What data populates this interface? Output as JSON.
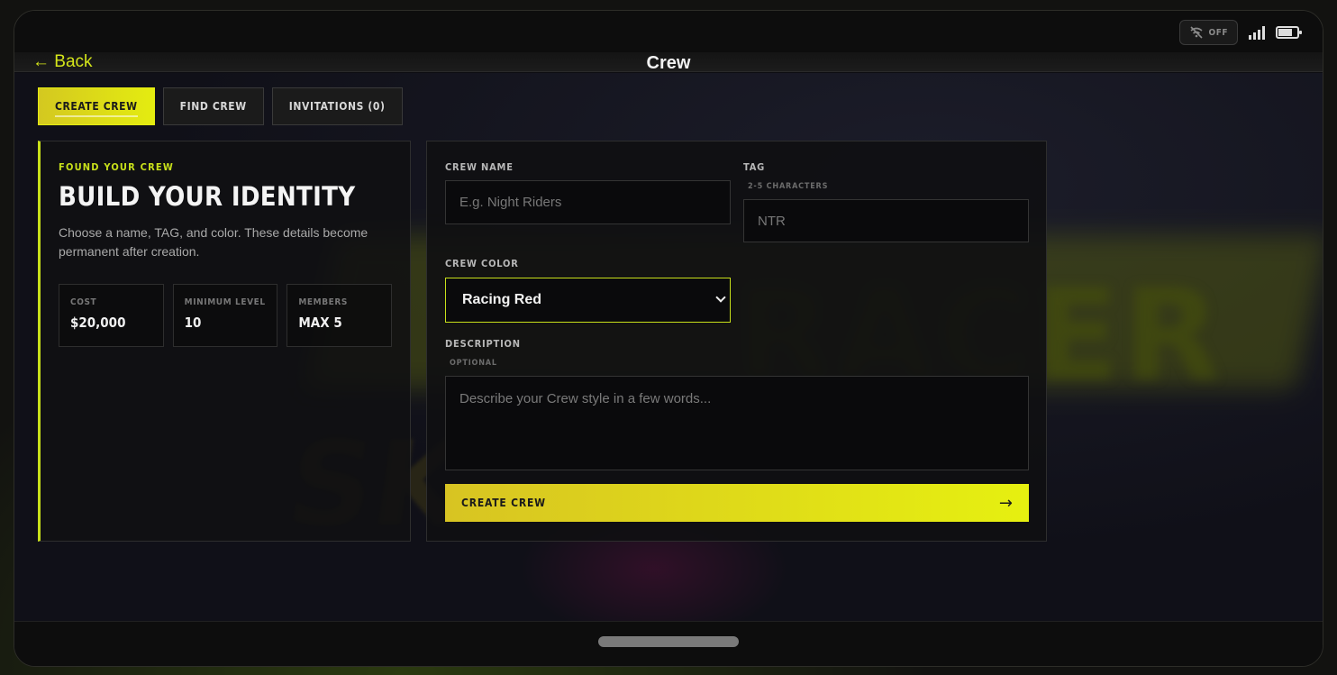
{
  "status": {
    "offline_label": "OFF",
    "offline_icon": "no-wifi-icon",
    "signal_icon": "signal-icon",
    "battery_icon": "battery-icon"
  },
  "header": {
    "back_label": "← Back",
    "title": "Crew"
  },
  "tabs": [
    {
      "label": "CREATE CREW",
      "active": true
    },
    {
      "label": "FIND CREW",
      "active": false
    },
    {
      "label": "INVITATIONS (0)",
      "active": false
    }
  ],
  "intro": {
    "eyebrow": "FOUND YOUR CREW",
    "heading": "BUILD YOUR IDENTITY",
    "description": "Choose a name, TAG, and color. These details become permanent after creation.",
    "stats": [
      {
        "label": "COST",
        "value": "$20,000"
      },
      {
        "label": "MINIMUM LEVEL",
        "value": "10"
      },
      {
        "label": "MEMBERS",
        "value": "MAX 5"
      }
    ]
  },
  "form": {
    "crew_name_label": "CREW NAME",
    "crew_name_placeholder": "E.g. Night Riders",
    "tag_label": "TAG",
    "tag_hint": "2-5 CHARACTERS",
    "tag_placeholder": "NTR",
    "color_label": "CREW COLOR",
    "color_value": "Racing Red",
    "description_label": "DESCRIPTION",
    "description_hint": "OPTIONAL",
    "description_placeholder": "Describe your Crew style in a few words...",
    "submit_label": "CREATE CREW",
    "submit_arrow": "→"
  },
  "colors": {
    "accent": "#d4e51a",
    "accent_gradient_start": "#d8c422",
    "accent_gradient_end": "#e6f010",
    "background": "#101018",
    "panel": "#101012"
  }
}
